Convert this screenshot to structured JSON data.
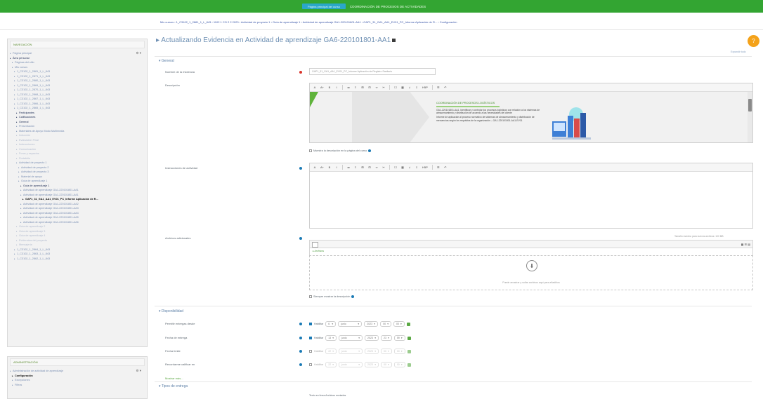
{
  "topbar": {
    "button_label": "Página principal del curso",
    "title": "COORDINACIÓN DE PROCESOS DE ACTIVIDADES"
  },
  "breadcrumb": "Mis cursos › 1_C3102_1_2881_1_L_843 › 1102 1 CO 2 2 2023 › Actividad de proyecto 1 › Guía de aprendizaje 1 › Actividad de aprendizaje GA1-220101801-AA1 › GAP1_31_GA1_AA1_EV01_PC_Informe Aplicación de R... › Configuración",
  "nav_block": {
    "title": "NAVEGACIÓN",
    "items": [
      {
        "label": "Página principal",
        "style": "normal",
        "indent": 0
      },
      {
        "label": "Área personal",
        "style": "dark",
        "indent": 0
      },
      {
        "label": "Páginas del sitio",
        "style": "normal",
        "indent": 1
      },
      {
        "label": "Mis cursos",
        "style": "normal",
        "indent": 1
      },
      {
        "label": "1_C3102_1_2881_1_L_843",
        "style": "normal",
        "indent": 2
      },
      {
        "label": "1_C3102_1_2871_1_L_843",
        "style": "normal",
        "indent": 2
      },
      {
        "label": "1_C3102_1_2880_1_L_843",
        "style": "normal",
        "indent": 2
      },
      {
        "label": "1_C3102_1_2869_1_L_843",
        "style": "normal",
        "indent": 2
      },
      {
        "label": "1_C3102_1_2870_1_L_843",
        "style": "normal",
        "indent": 2
      },
      {
        "label": "1_C3102_1_2868_1_L_843",
        "style": "normal",
        "indent": 2
      },
      {
        "label": "1_C3102_1_2867_1_L_843",
        "style": "normal",
        "indent": 2
      },
      {
        "label": "1_C3102_1_2866_1_L_843",
        "style": "normal",
        "indent": 2
      },
      {
        "label": "1_C3102_1_2865_1_L_843",
        "style": "normal",
        "indent": 2
      },
      {
        "label": "Participantes",
        "style": "dark",
        "indent": 3
      },
      {
        "label": "Calificaciones",
        "style": "dark",
        "indent": 3
      },
      {
        "label": "General",
        "style": "dark",
        "indent": 3
      },
      {
        "label": "Presentación",
        "style": "normal",
        "indent": 3
      },
      {
        "label": "Materiales de Apoyo Modo Multimedia",
        "style": "normal",
        "indent": 3
      },
      {
        "label": "Inducción",
        "style": "muted",
        "indent": 3
      },
      {
        "label": "Evaluación Final",
        "style": "muted",
        "indent": 3
      },
      {
        "label": "Instrucciones",
        "style": "muted",
        "indent": 3
      },
      {
        "label": "Comunicación",
        "style": "muted",
        "indent": 3
      },
      {
        "label": "Foros y espacios",
        "style": "muted",
        "indent": 3
      },
      {
        "label": "Portafolio",
        "style": "muted",
        "indent": 3
      },
      {
        "label": "Actividad de proyecto 1",
        "style": "normal",
        "indent": 3
      },
      {
        "label": "Actividad de proyecto 2",
        "style": "normal",
        "indent": 4
      },
      {
        "label": "Actividad de proyecto 3",
        "style": "normal",
        "indent": 4
      },
      {
        "label": "Material de apoyo",
        "style": "normal",
        "indent": 4
      },
      {
        "label": "Guía de aprendizaje 1",
        "style": "normal",
        "indent": 4
      },
      {
        "label": "Guía de aprendizaje 1",
        "style": "dark",
        "indent": 5
      },
      {
        "label": "Actividad de aprendizaje GA1-220101801-AA1",
        "style": "normal",
        "indent": 5
      },
      {
        "label": "Actividad de aprendizaje GA1-220101801-AA1",
        "style": "normal",
        "indent": 5
      },
      {
        "label": "GAP1_31_GA1_AA1_EV01_PC_Informe Aplicación de R...",
        "style": "current",
        "indent": 6
      },
      {
        "label": "Actividad de aprendizaje GA1-220101801-AA2",
        "style": "normal",
        "indent": 5
      },
      {
        "label": "Actividad de aprendizaje GA1-220101801-AA3",
        "style": "normal",
        "indent": 5
      },
      {
        "label": "Actividad de aprendizaje GA1-220101801-AA4",
        "style": "normal",
        "indent": 5
      },
      {
        "label": "Actividad de aprendizaje GA1-220101801-AA5",
        "style": "normal",
        "indent": 5
      },
      {
        "label": "Actividad de aprendizaje GA1-220101801-AA6",
        "style": "normal",
        "indent": 5
      },
      {
        "label": "Guía de aprendizaje 2",
        "style": "muted",
        "indent": 3
      },
      {
        "label": "Guía de aprendizaje 3",
        "style": "muted",
        "indent": 3
      },
      {
        "label": "Guía de aprendizaje 4",
        "style": "muted",
        "indent": 3
      },
      {
        "label": "Evidencias del proyecto",
        "style": "muted",
        "indent": 3
      },
      {
        "label": "Mensajería",
        "style": "muted",
        "indent": 3
      },
      {
        "label": "1_C3102_1_2864_1_L_843",
        "style": "normal",
        "indent": 2
      },
      {
        "label": "1_C3102_1_2863_1_L_843",
        "style": "normal",
        "indent": 2
      },
      {
        "label": "1_C3102_1_2862_1_L_843",
        "style": "normal",
        "indent": 2
      }
    ]
  },
  "admin_block": {
    "title": "ADMINISTRACIÓN",
    "items": [
      {
        "label": "Administración de actividad de aprendizaje",
        "style": "normal",
        "indent": 0
      },
      {
        "label": "Configuración",
        "style": "current",
        "indent": 1
      },
      {
        "label": "Excepciones",
        "style": "normal",
        "indent": 1
      },
      {
        "label": "Filtros",
        "style": "normal",
        "indent": 1
      }
    ]
  },
  "page": {
    "title": "Actualizando Evidencia en Actividad de aprendizaje GA6-220101801-AA1",
    "help_link": "Expandir todo"
  },
  "sections": {
    "general": "General",
    "availability": "Disponibilidad",
    "submission_types": "Tipos de entrega"
  },
  "fields": {
    "name_label": "Nombre de la evidencia",
    "name_value": "GAP1_31_GA1_AA1_EV01_PC_Informe Aplicación de Registro Sanitario",
    "description_label": "Descripción",
    "show_description_label": "Muestra la descripción en la página del curso",
    "activity_instructions_label": "Instrucciones de actividad",
    "additional_files_label": "Archivos adicionales",
    "additional_files_max": "Tamaño máximo para nuevos archivos: 100 MB",
    "files_path": "Archivos",
    "drop_hint": "Puede arrastrar y soltar archivos aquí para añadirlos",
    "show_files_label": "Siempre mostrar la descripción"
  },
  "editor_toolbar": [
    "A",
    "A+",
    "B",
    "I",
    "≔",
    "≡",
    "⊞",
    "⊟",
    "∞",
    "✂",
    "☐",
    "▦",
    "♫",
    "⇩",
    "H5P",
    "☰",
    "↶"
  ],
  "banner": {
    "green_heading": "COORDINACIÓN DE PROCESOS LOGÍSTICOS",
    "text_1": "GA1-220101801-AA1. Identificar y controlar los procesos logísticos con relación a los sistemas de almacenamiento y distribución de acuerdo a las necesidades del cliente",
    "text_2": "Informe de aplicación al proceso normativo de sistemas de almacenamiento y distribución de mercancías según los requisitos de la organización – GA1-220101801-AA1-EV01"
  },
  "date_rows": [
    {
      "label": "Permitir entregas desde",
      "enabled": true,
      "enable_text": "Habilitar",
      "day": "6",
      "month": "junio",
      "year": "2023",
      "hour": "00",
      "minute": "00"
    },
    {
      "label": "Fecha de entrega",
      "enabled": true,
      "enable_text": "Habilitar",
      "day": "13",
      "month": "junio",
      "year": "2023",
      "hour": "23",
      "minute": "59"
    },
    {
      "label": "Fecha límite",
      "enabled": false,
      "enable_text": "Habilitar",
      "day": "22",
      "month": "junio",
      "year": "2023",
      "hour": "00",
      "minute": "00"
    },
    {
      "label": "Recordarme calificar en",
      "enabled": false,
      "enable_text": "Habilitar",
      "day": "22",
      "month": "junio",
      "year": "2023",
      "hour": "00",
      "minute": "00"
    }
  ],
  "submission_note": "Mostrar más...",
  "submission_types_row": "Texto en línea   Archivos enviados",
  "colors": {
    "topbar": "#33a532",
    "accent_blue": "#1a7ab5",
    "required_red": "#d9342b",
    "help_orange": "#f4a21a"
  }
}
